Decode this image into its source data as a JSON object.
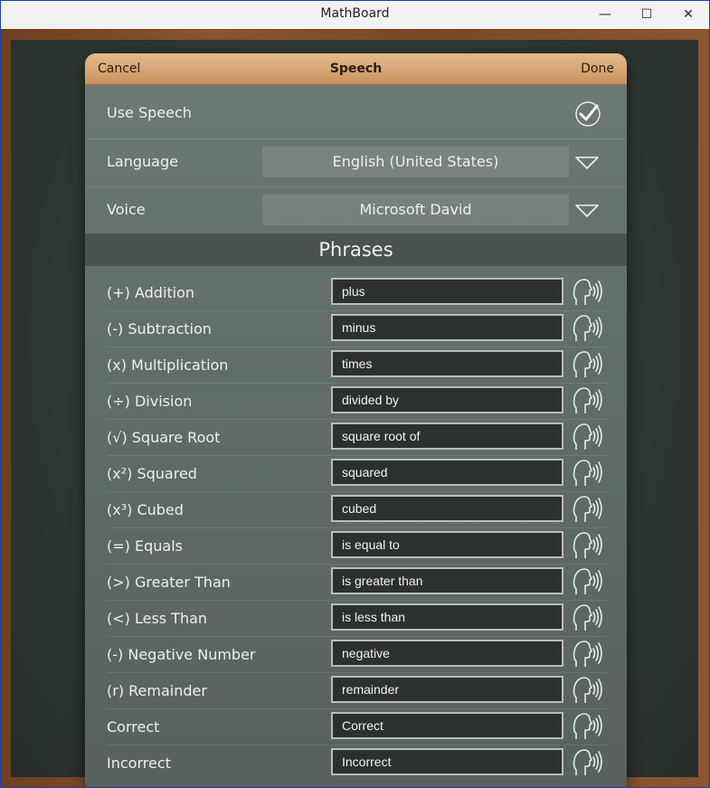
{
  "window": {
    "title": "MathBoard",
    "controls": {
      "minimize": "—",
      "maximize": "☐",
      "close": "✕"
    }
  },
  "dialog": {
    "cancel_label": "Cancel",
    "title": "Speech",
    "done_label": "Done",
    "use_speech": {
      "label": "Use Speech",
      "checked": true
    },
    "language": {
      "label": "Language",
      "value": "English (United States)"
    },
    "voice": {
      "label": "Voice",
      "value": "Microsoft David"
    },
    "phrases_heading": "Phrases",
    "phrases": [
      {
        "label": "(+) Addition",
        "value": "plus"
      },
      {
        "label": "(-) Subtraction",
        "value": "minus"
      },
      {
        "label": "(x) Multiplication",
        "value": "times"
      },
      {
        "label": "(÷) Division",
        "value": "divided by"
      },
      {
        "label": "(√) Square Root",
        "value": "square root of"
      },
      {
        "label": "(x²) Squared",
        "value": "squared"
      },
      {
        "label": "(x³) Cubed",
        "value": "cubed"
      },
      {
        "label": "(=) Equals",
        "value": "is equal to"
      },
      {
        "label": "(>) Greater Than",
        "value": "is greater than"
      },
      {
        "label": "(<) Less Than",
        "value": "is less than"
      },
      {
        "label": "(-) Negative Number",
        "value": "negative"
      },
      {
        "label": "(r) Remainder",
        "value": "remainder"
      },
      {
        "label": "Correct",
        "value": "Correct"
      },
      {
        "label": "Incorrect",
        "value": "Incorrect"
      }
    ]
  },
  "icons": {
    "check": "check-icon",
    "dropdown": "chevron-down-icon",
    "speak": "speaking-head-icon"
  },
  "colors": {
    "header_wood": "#d9a877",
    "dialog_bg": "#616d67",
    "chalkboard": "#2c3530",
    "input_bg": "#2c302e"
  }
}
